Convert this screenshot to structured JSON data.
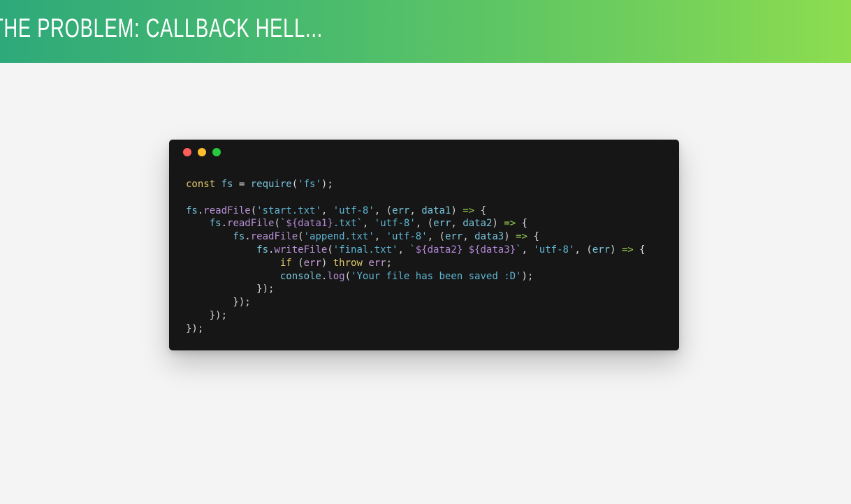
{
  "slide": {
    "title": "The Problem: Callback Hell..."
  },
  "window": {
    "dots": [
      {
        "name": "close-dot",
        "color": "#ff5f56"
      },
      {
        "name": "minimize-dot",
        "color": "#ffbd2e"
      },
      {
        "name": "maximize-dot",
        "color": "#27c93f"
      }
    ]
  },
  "code": {
    "lines": [
      [
        [
          "kw",
          "const "
        ],
        [
          "id",
          "fs"
        ],
        [
          "p",
          " = "
        ],
        [
          "id",
          "require"
        ],
        [
          "p",
          "("
        ],
        [
          "str",
          "'fs'"
        ],
        [
          "p",
          ");"
        ]
      ],
      [],
      [
        [
          "id",
          "fs"
        ],
        [
          "p",
          "."
        ],
        [
          "fn",
          "readFile"
        ],
        [
          "p",
          "("
        ],
        [
          "str",
          "'start.txt'"
        ],
        [
          "p",
          ", "
        ],
        [
          "str",
          "'utf-8'"
        ],
        [
          "p",
          ", ("
        ],
        [
          "id",
          "err"
        ],
        [
          "p",
          ", "
        ],
        [
          "id",
          "data1"
        ],
        [
          "p",
          ") "
        ],
        [
          "op",
          "=>"
        ],
        [
          "p",
          " {"
        ]
      ],
      [
        [
          "p",
          "    "
        ],
        [
          "id",
          "fs"
        ],
        [
          "p",
          "."
        ],
        [
          "fn",
          "readFile"
        ],
        [
          "p",
          "("
        ],
        [
          "str",
          "`"
        ],
        [
          "tpl",
          "${data1}"
        ],
        [
          "str",
          ".txt`"
        ],
        [
          "p",
          ", "
        ],
        [
          "str",
          "'utf-8'"
        ],
        [
          "p",
          ", ("
        ],
        [
          "id",
          "err"
        ],
        [
          "p",
          ", "
        ],
        [
          "id",
          "data2"
        ],
        [
          "p",
          ") "
        ],
        [
          "op",
          "=>"
        ],
        [
          "p",
          " {"
        ]
      ],
      [
        [
          "p",
          "        "
        ],
        [
          "id",
          "fs"
        ],
        [
          "p",
          "."
        ],
        [
          "fn",
          "readFile"
        ],
        [
          "p",
          "("
        ],
        [
          "str",
          "'append.txt'"
        ],
        [
          "p",
          ", "
        ],
        [
          "str",
          "'utf-8'"
        ],
        [
          "p",
          ", ("
        ],
        [
          "id",
          "err"
        ],
        [
          "p",
          ", "
        ],
        [
          "id",
          "data3"
        ],
        [
          "p",
          ") "
        ],
        [
          "op",
          "=>"
        ],
        [
          "p",
          " {"
        ]
      ],
      [
        [
          "p",
          "            "
        ],
        [
          "id",
          "fs"
        ],
        [
          "p",
          "."
        ],
        [
          "fn",
          "writeFile"
        ],
        [
          "p",
          "("
        ],
        [
          "str",
          "'final.txt'"
        ],
        [
          "p",
          ", "
        ],
        [
          "str",
          "`"
        ],
        [
          "tpl",
          "${data2}"
        ],
        [
          "str",
          " "
        ],
        [
          "tpl",
          "${data3}"
        ],
        [
          "str",
          "`"
        ],
        [
          "p",
          ", "
        ],
        [
          "str",
          "'utf-8'"
        ],
        [
          "p",
          ", ("
        ],
        [
          "id",
          "err"
        ],
        [
          "p",
          ") "
        ],
        [
          "op",
          "=>"
        ],
        [
          "p",
          " {"
        ]
      ],
      [
        [
          "p",
          "                "
        ],
        [
          "kw",
          "if "
        ],
        [
          "p",
          "("
        ],
        [
          "kw2",
          "err"
        ],
        [
          "p",
          ") "
        ],
        [
          "kw",
          "throw "
        ],
        [
          "kw2",
          "err"
        ],
        [
          "p",
          ";"
        ]
      ],
      [
        [
          "p",
          "                "
        ],
        [
          "id",
          "console"
        ],
        [
          "p",
          "."
        ],
        [
          "fn",
          "log"
        ],
        [
          "p",
          "("
        ],
        [
          "str",
          "'Your file has been saved :D'"
        ],
        [
          "p",
          ");"
        ]
      ],
      [
        [
          "p",
          "            });"
        ]
      ],
      [
        [
          "p",
          "        });"
        ]
      ],
      [
        [
          "p",
          "    });"
        ]
      ],
      [
        [
          "p",
          "});"
        ]
      ]
    ]
  }
}
